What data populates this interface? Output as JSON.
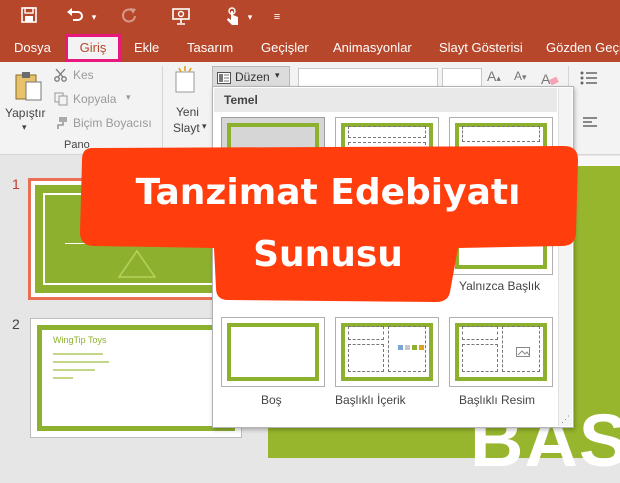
{
  "colors": {
    "accent": "#b7472a",
    "highlight": "#e8197d",
    "slide_green": "#8db12e",
    "banner": "#ff3d0d"
  },
  "qat": {
    "icons": [
      "save-icon",
      "undo-icon",
      "redo-icon",
      "present-icon",
      "touch-mode-icon",
      "customize-icon"
    ]
  },
  "tabs": [
    "Dosya",
    "Giriş",
    "Ekle",
    "Tasarım",
    "Geçişler",
    "Animasyonlar",
    "Slayt Gösterisi",
    "Gözden Geçir"
  ],
  "ribbon": {
    "paste": "Yapıştır",
    "cut": "Kes",
    "copy": "Kopyala",
    "format_painter": "Biçim Boyacısı",
    "clipboard_group": "Pano",
    "new_slide_1": "Yeni",
    "new_slide_2": "Slayt",
    "layout": "Düzen"
  },
  "slides": {
    "num1": "1",
    "num2": "2",
    "thumb2_title": "WingTip Toys",
    "main_text": "BAS"
  },
  "gallery": {
    "header": "Temel",
    "layouts": [
      "Yalnızca Başlık",
      "Boş",
      "Başlıklı İçerik",
      "Başlıklı Resim"
    ]
  },
  "banner": {
    "line1": "Tanzimat Edebiyatı",
    "line2": "Sunusu"
  }
}
